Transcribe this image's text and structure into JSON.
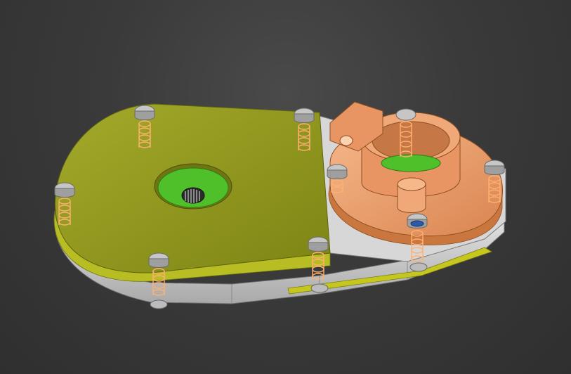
{
  "viewport": {
    "background": "#3b3b3b"
  },
  "colors": {
    "cover_plate": "#8f961a",
    "cover_plate_top": "#9aa024",
    "cover_plate_edge": "#d4d93a",
    "housing_body": "#c9c9c9",
    "housing_side_light": "#e4e4e4",
    "mount_bracket": "#f0a878",
    "mount_bracket_shade": "#d98a58",
    "bearing_ring": "#4fbf2a",
    "bolt_highlight": "#ffb070",
    "bolt_head": "#b8b8b8"
  },
  "icons": {
    "shaft_bore": "gear-spline-icon",
    "bolt": "hex-bolt-icon"
  }
}
